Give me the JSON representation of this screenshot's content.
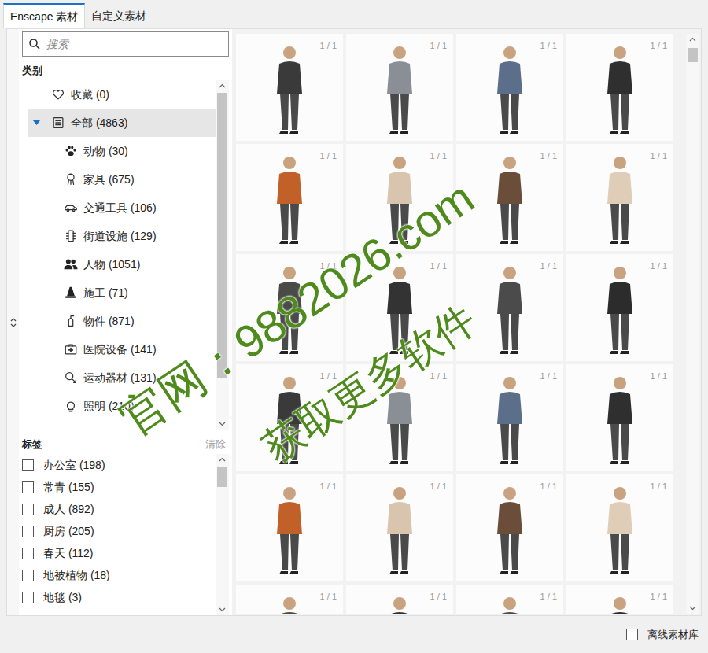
{
  "tabs": [
    {
      "label": "Enscape 素材",
      "selected": true
    },
    {
      "label": "自定义素材",
      "selected": false
    }
  ],
  "search": {
    "placeholder": "搜索"
  },
  "categories": {
    "heading": "类别",
    "items": [
      {
        "label": "收藏 (0)",
        "kind": "root",
        "expanded": false,
        "selected": false
      },
      {
        "label": "全部 (4863)",
        "kind": "root",
        "expanded": true,
        "selected": true
      },
      {
        "label": "动物 (30)",
        "kind": "child",
        "expanded": false,
        "selected": false
      },
      {
        "label": "家具 (675)",
        "kind": "child",
        "expanded": false,
        "selected": false
      },
      {
        "label": "交通工具 (106)",
        "kind": "child",
        "expanded": false,
        "selected": false
      },
      {
        "label": "街道设施 (129)",
        "kind": "child",
        "expanded": false,
        "selected": false
      },
      {
        "label": "人物 (1051)",
        "kind": "child",
        "expanded": false,
        "selected": false
      },
      {
        "label": "施工 (71)",
        "kind": "child",
        "expanded": false,
        "selected": false
      },
      {
        "label": "物件 (871)",
        "kind": "child",
        "expanded": false,
        "selected": false
      },
      {
        "label": "医院设备 (141)",
        "kind": "child",
        "expanded": false,
        "selected": false
      },
      {
        "label": "运动器材 (131)",
        "kind": "child",
        "expanded": false,
        "selected": false
      },
      {
        "label": "照明 (210)",
        "kind": "child",
        "expanded": false,
        "selected": false
      }
    ]
  },
  "tags": {
    "heading": "标签",
    "clear": "清除",
    "items": [
      {
        "label": "办公室 (198)",
        "checked": false
      },
      {
        "label": "常青 (155)",
        "checked": false
      },
      {
        "label": "成人 (892)",
        "checked": false
      },
      {
        "label": "厨房 (205)",
        "checked": false
      },
      {
        "label": "春天 (112)",
        "checked": false
      },
      {
        "label": "地被植物 (18)",
        "checked": false
      },
      {
        "label": "地毯 (3)",
        "checked": false
      }
    ]
  },
  "assets": [
    {
      "counter": "1 / 1"
    },
    {
      "counter": "1 / 1"
    },
    {
      "counter": "1 / 1"
    },
    {
      "counter": "1 / 1"
    },
    {
      "counter": "1 / 1"
    },
    {
      "counter": "1 / 1"
    },
    {
      "counter": "1 / 1"
    },
    {
      "counter": "1 / 1"
    },
    {
      "counter": "1 / 1"
    },
    {
      "counter": "1 / 1"
    },
    {
      "counter": "1 / 1"
    },
    {
      "counter": "1 / 1"
    },
    {
      "counter": "1 / 1"
    },
    {
      "counter": "1 / 1"
    },
    {
      "counter": "1 / 1"
    },
    {
      "counter": "1 / 1"
    },
    {
      "counter": "1 / 1"
    },
    {
      "counter": "1 / 1"
    },
    {
      "counter": "1 / 1"
    },
    {
      "counter": "1 / 1"
    },
    {
      "counter": "1 / 1"
    },
    {
      "counter": "1 / 1"
    },
    {
      "counter": "1 / 1"
    },
    {
      "counter": "1 / 1"
    }
  ],
  "footer": {
    "label": "离线素材库",
    "checked": false
  },
  "watermark": {
    "lines": [
      "官网：9882026.com",
      "获取更多软件"
    ]
  }
}
